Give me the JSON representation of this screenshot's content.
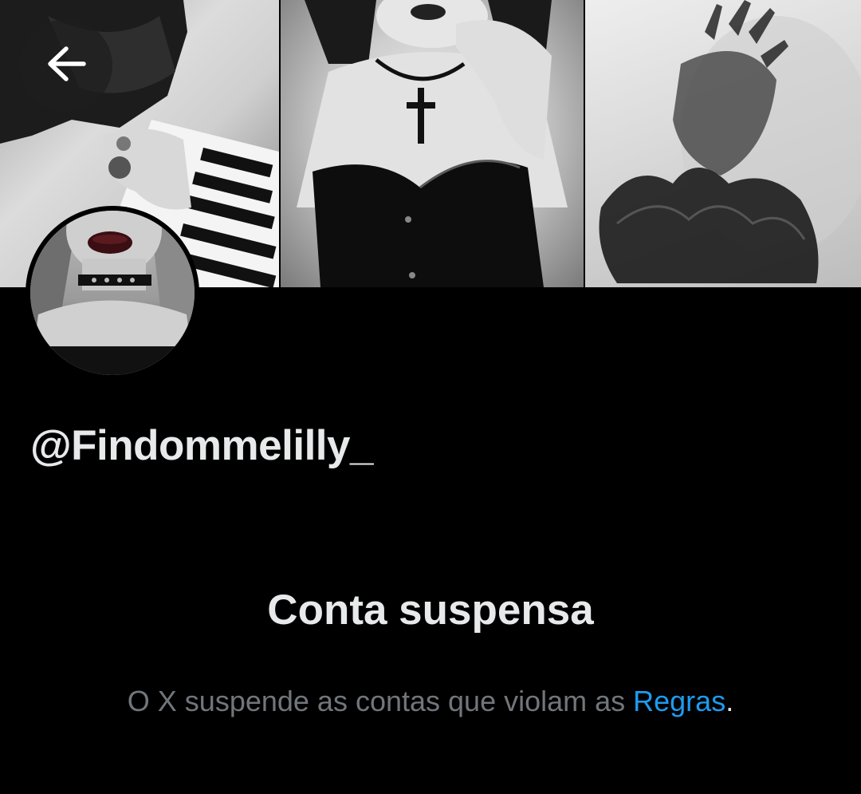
{
  "header": {
    "back_icon": "arrow-left-icon",
    "banner_images": [
      "piano-hand-photo",
      "corset-cross-necklace-photo",
      "lace-glove-hand-photo"
    ],
    "colors": {
      "background": "#000000",
      "back_button_bg": "#1e1e1e"
    }
  },
  "profile": {
    "avatar": "profile-avatar-photo",
    "handle": "@Findommelilly_"
  },
  "suspension": {
    "title": "Conta suspensa",
    "message_prefix": "O X suspende as contas que violam as ",
    "rules_link": "Regras",
    "message_suffix": "."
  },
  "colors": {
    "primary_text": "#e7e9ea",
    "secondary_text": "#71767b",
    "link": "#1d9bf0"
  }
}
